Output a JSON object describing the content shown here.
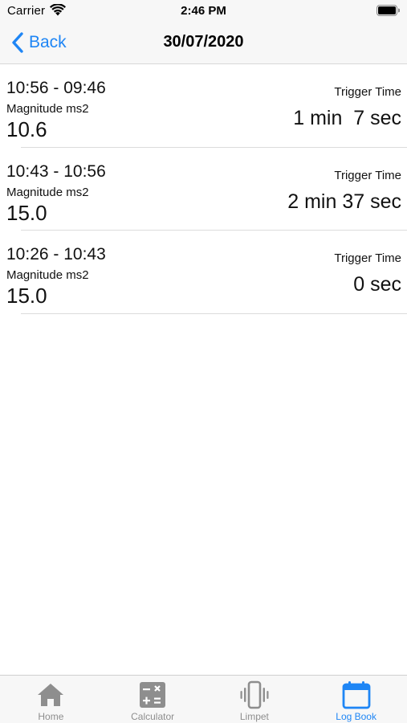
{
  "status_bar": {
    "carrier": "Carrier",
    "time": "2:46 PM"
  },
  "nav": {
    "back_label": "Back",
    "title": "30/07/2020"
  },
  "logs": [
    {
      "time_range": "10:56 - 09:46",
      "magnitude_label": "Magnitude ms2",
      "magnitude_value": "10.6",
      "trigger_label": "Trigger Time",
      "trigger_value": "1 min  7 sec"
    },
    {
      "time_range": "10:43 - 10:56",
      "magnitude_label": "Magnitude ms2",
      "magnitude_value": "15.0",
      "trigger_label": "Trigger Time",
      "trigger_value": "2 min 37 sec"
    },
    {
      "time_range": "10:26 - 10:43",
      "magnitude_label": "Magnitude ms2",
      "magnitude_value": "15.0",
      "trigger_label": "Trigger Time",
      "trigger_value": "0 sec"
    }
  ],
  "tabs": [
    {
      "label": "Home",
      "icon": "home-icon"
    },
    {
      "label": "Calculator",
      "icon": "calculator-icon"
    },
    {
      "label": "Limpet",
      "icon": "vibrating-phone-icon"
    },
    {
      "label": "Log Book",
      "icon": "calendar-icon",
      "active": true
    }
  ],
  "colors": {
    "accent": "#1f86f5",
    "inactive_tab": "#8e8e8e",
    "bar_background": "#f7f7f7"
  }
}
